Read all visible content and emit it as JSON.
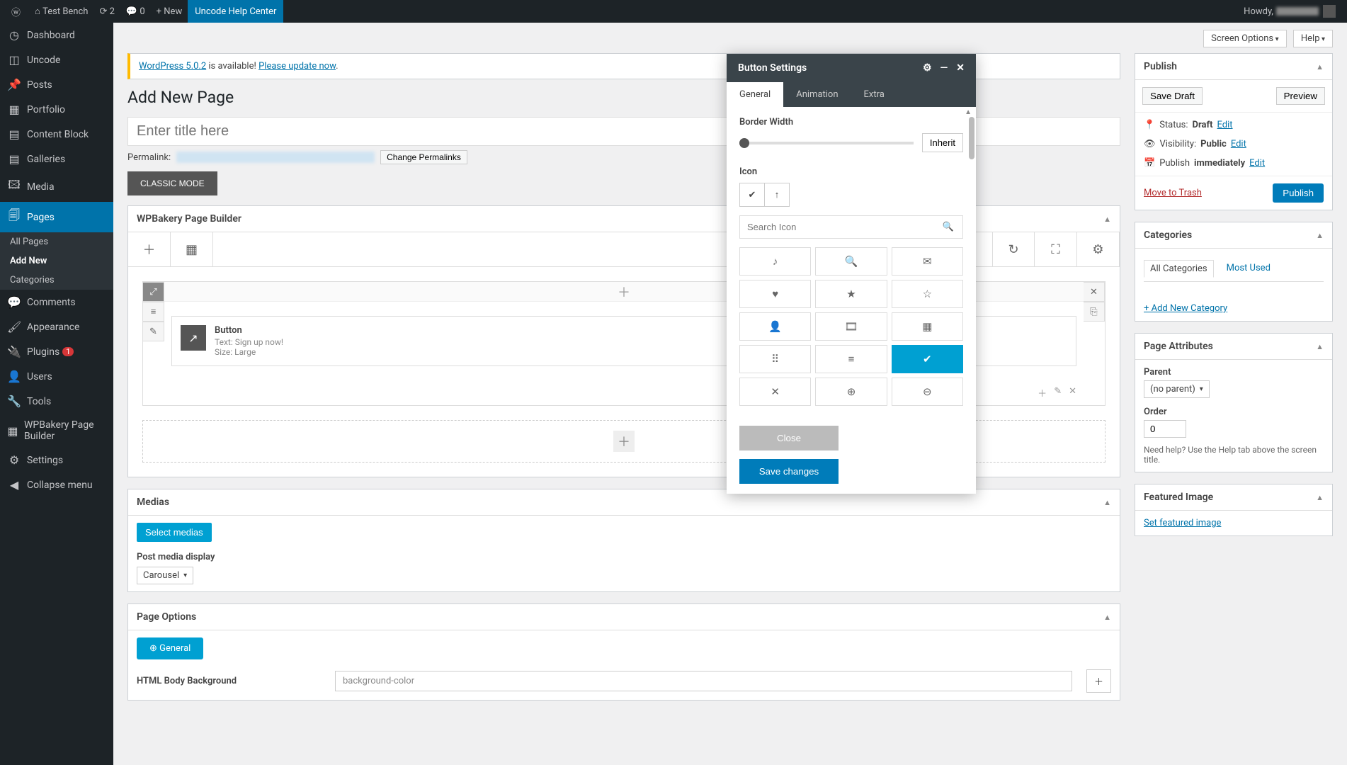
{
  "adminbar": {
    "site_name": "Test Bench",
    "updates_count": "2",
    "comments_count": "0",
    "new_label": "New",
    "help_center": "Uncode Help Center",
    "howdy": "Howdy,"
  },
  "sidebar": {
    "items": [
      {
        "label": "Dashboard",
        "icon": "⌂"
      },
      {
        "label": "Uncode",
        "icon": "◫"
      },
      {
        "label": "Posts",
        "icon": "✎"
      },
      {
        "label": "Portfolio",
        "icon": "▦"
      },
      {
        "label": "Content Block",
        "icon": "▤"
      },
      {
        "label": "Galleries",
        "icon": "▤"
      },
      {
        "label": "Media",
        "icon": "🖼"
      },
      {
        "label": "Pages",
        "icon": "📄"
      },
      {
        "label": "Comments",
        "icon": "💬"
      },
      {
        "label": "Appearance",
        "icon": "✦"
      },
      {
        "label": "Plugins",
        "icon": "🔌",
        "badge": "1"
      },
      {
        "label": "Users",
        "icon": "👤"
      },
      {
        "label": "Tools",
        "icon": "🔧"
      },
      {
        "label": "WPBakery Page Builder",
        "icon": "▦"
      },
      {
        "label": "Settings",
        "icon": "⚙"
      },
      {
        "label": "Collapse menu",
        "icon": "◀"
      }
    ],
    "pages_submenu": [
      {
        "label": "All Pages"
      },
      {
        "label": "Add New"
      },
      {
        "label": "Categories"
      }
    ]
  },
  "top_actions": {
    "screen_options": "Screen Options",
    "help": "Help"
  },
  "update_notice": {
    "text_link": "WordPress 5.0.2",
    "text_mid": " is available! ",
    "text_link2": "Please update now",
    "text_end": "."
  },
  "page": {
    "title": "Add New Page",
    "title_placeholder": "Enter title here",
    "permalink_label": "Permalink:",
    "change_permalinks": "Change Permalinks",
    "classic_mode": "CLASSIC MODE"
  },
  "builder": {
    "panel_title": "WPBakery Page Builder",
    "element": {
      "title": "Button",
      "text_line": "Text: Sign up now!",
      "size_line": "Size: Large"
    }
  },
  "medias": {
    "panel_title": "Medias",
    "select_btn": "Select medias",
    "display_label": "Post media display",
    "display_value": "Carousel"
  },
  "page_options": {
    "panel_title": "Page Options",
    "tab_general": "General",
    "bg_label": "HTML Body Background",
    "bg_value": "background-color"
  },
  "publish": {
    "panel_title": "Publish",
    "save_draft": "Save Draft",
    "preview": "Preview",
    "status_label": "Status:",
    "status_value": "Draft",
    "visibility_label": "Visibility:",
    "visibility_value": "Public",
    "publish_label": "Publish",
    "publish_value": "immediately",
    "edit": "Edit",
    "trash": "Move to Trash",
    "publish_btn": "Publish"
  },
  "categories": {
    "panel_title": "Categories",
    "tab_all": "All Categories",
    "tab_most": "Most Used",
    "add_new": "+ Add New Category"
  },
  "attributes": {
    "panel_title": "Page Attributes",
    "parent_label": "Parent",
    "parent_value": "(no parent)",
    "order_label": "Order",
    "order_value": "0",
    "help_text": "Need help? Use the Help tab above the screen title."
  },
  "featured": {
    "panel_title": "Featured Image",
    "link": "Set featured image"
  },
  "modal": {
    "title": "Button Settings",
    "tabs": {
      "general": "General",
      "animation": "Animation",
      "extra": "Extra"
    },
    "border_width_label": "Border Width",
    "inherit": "Inherit",
    "icon_label": "Icon",
    "search_placeholder": "Search Icon",
    "icons": [
      "♪",
      "🔍",
      "✉",
      "♥",
      "★",
      "☆",
      "👤",
      "🎞",
      "▦",
      "⠿",
      "≡",
      "✔",
      "✕",
      "⊕",
      "⊖"
    ],
    "selected_icon_index": 11,
    "close": "Close",
    "save": "Save changes"
  }
}
